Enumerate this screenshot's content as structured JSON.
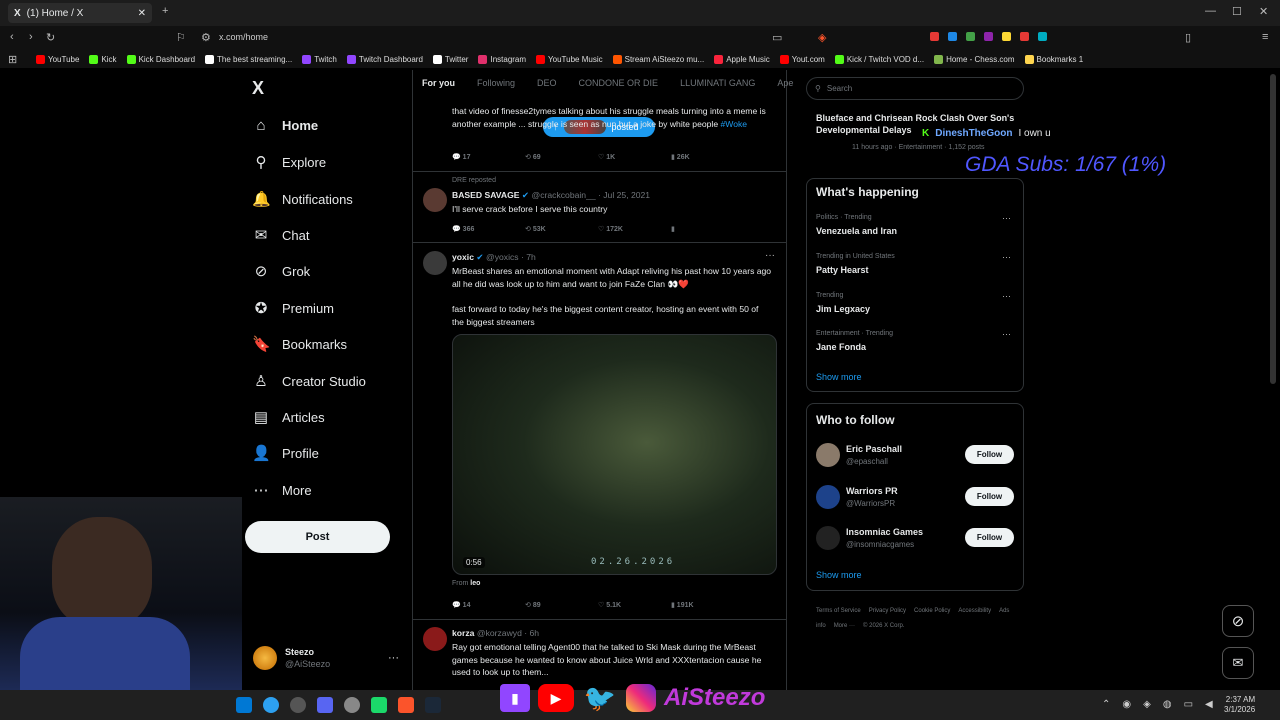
{
  "browser": {
    "tab_title": "(1) Home / X",
    "url": "x.com/home",
    "bookmarks": [
      "YouTube",
      "Kick",
      "Kick Dashboard",
      "The best streaming...",
      "Twitch",
      "Twitch Dashboard",
      "Twitter",
      "Instagram",
      "YouTube Music",
      "Stream AiSteezo mu...",
      "Apple Music",
      "Yout.com",
      "Kick / Twitch VOD d...",
      "Home - Chess.com",
      "Bookmarks 1"
    ],
    "bookmark_colors": [
      "#ff0000",
      "#53fc18",
      "#53fc18",
      "#ffffff",
      "#9146ff",
      "#9146ff",
      "#ffffff",
      "#e1306c",
      "#ff0000",
      "#ff5500",
      "#fa243c",
      "#ff0000",
      "#53fc18",
      "#81b64c",
      "#ffd54f"
    ]
  },
  "nav": {
    "logo": "X",
    "items": [
      {
        "label": "Home",
        "icon": "⌂"
      },
      {
        "label": "Explore",
        "icon": "⚲"
      },
      {
        "label": "Notifications",
        "icon": "🔔"
      },
      {
        "label": "Chat",
        "icon": "✉"
      },
      {
        "label": "Grok",
        "icon": "⊘"
      },
      {
        "label": "Premium",
        "icon": "✪"
      },
      {
        "label": "Bookmarks",
        "icon": "🔖"
      },
      {
        "label": "Creator Studio",
        "icon": "♙"
      },
      {
        "label": "Articles",
        "icon": "▤"
      },
      {
        "label": "Profile",
        "icon": "👤"
      },
      {
        "label": "More",
        "icon": "⋯"
      }
    ],
    "post_label": "Post",
    "account_name": "Steezo",
    "account_handle": "@AiSteezo"
  },
  "feed": {
    "tabs": [
      "For you",
      "Following",
      "DEO",
      "CONDONE OR DIE",
      "LLUMINATI GANG",
      "Ape"
    ],
    "posted_pill": "posted",
    "tweet1": {
      "text": "that video of finesse2tymes talking about his struggle meals turning into a meme is another example ... struggle is seen as nun but a joke by white people",
      "hashtag": "#Woke",
      "replies": "17",
      "reposts": "69",
      "likes": "1K",
      "views": "26K"
    },
    "tweet2": {
      "repost_by": "DRE reposted",
      "name": "BASED SAVAGE",
      "handle": "@crackcobain__ · Jul 25, 2021",
      "text": "I'll serve crack before I serve this country",
      "replies": "366",
      "reposts": "53K",
      "likes": "172K"
    },
    "tweet3": {
      "name": "yoxic",
      "handle": "@yoxics · 7h",
      "text1": "MrBeast shares an emotional moment with Adapt reliving his past how 10 years ago all he did was look up to him and want to join FaZe Clan 👀❤️",
      "text2": "fast forward to today he's the biggest content creator, hosting an event with 50 of the biggest streamers",
      "video_time": "0:56",
      "video_date": "02.26.2026",
      "from_label": "From",
      "from_name": "leo",
      "replies": "14",
      "reposts": "89",
      "likes": "5.1K",
      "views": "191K"
    },
    "tweet4": {
      "name": "korza",
      "handle": "@korzawyd · 6h",
      "text": "Ray got emotional telling Agent00 that he talked to Ski Mask during the MrBeast games because he wanted to know about Juice Wrld and XXXtentacion cause he used to look up to them..."
    }
  },
  "right": {
    "search_placeholder": "Search",
    "top_story": {
      "title": "Blueface and Chrisean Rock Clash Over Son's Developmental Delays",
      "meta": "11 hours ago · Entertainment · 1,152 posts"
    },
    "happening_title": "What's happening",
    "trends": [
      {
        "context": "Politics · Trending",
        "title": "Venezuela and Iran"
      },
      {
        "context": "Trending in United States",
        "title": "Patty Hearst"
      },
      {
        "context": "Trending",
        "title": "Jim Legxacy"
      },
      {
        "context": "Entertainment · Trending",
        "title": "Jane Fonda"
      }
    ],
    "show_more": "Show more",
    "who_to_follow_title": "Who to follow",
    "follow_suggestions": [
      {
        "name": "Eric Paschall",
        "handle": "@epaschall"
      },
      {
        "name": "Warriors PR",
        "handle": "@WarriorsPR"
      },
      {
        "name": "Insomniac Games",
        "handle": "@insomniacgames"
      }
    ],
    "follow_label": "Follow",
    "footer_links": [
      "Terms of Service",
      "Privacy Policy",
      "Cookie Policy",
      "Accessibility",
      "Ads info",
      "More ···",
      "© 2026 X Corp."
    ]
  },
  "overlay": {
    "chat_user": "DineshTheGoon",
    "chat_msg": "I own u",
    "subs": "GDA Subs: 1/67 (1%)",
    "social_name": "AiSteezo"
  },
  "taskbar": {
    "time": "2:37 AM",
    "date": "3/1/2026"
  }
}
